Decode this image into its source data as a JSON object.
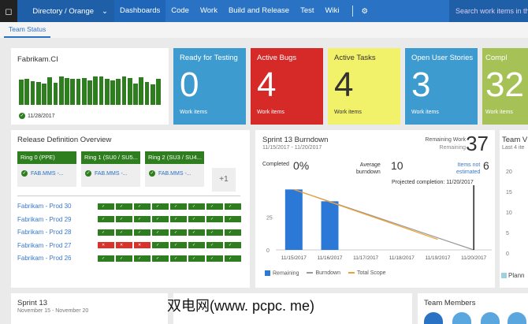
{
  "topnav": {
    "directory": "Directory / Orange",
    "items": [
      "Dashboards",
      "Code",
      "Work",
      "Build and Release",
      "Test",
      "Wiki"
    ],
    "active": "Dashboards",
    "search_placeholder": "Search work items in this"
  },
  "subnav": {
    "tab": "Team Status"
  },
  "build": {
    "title": "Fabrikam.CI",
    "date": "11/28/2017",
    "bar_heights": [
      0.72,
      0.74,
      0.68,
      0.66,
      0.62,
      0.8,
      0.63,
      0.82,
      0.78,
      0.75,
      0.75,
      0.78,
      0.7,
      0.82,
      0.82,
      0.76,
      0.7,
      0.76,
      0.82,
      0.78,
      0.62,
      0.8,
      0.66,
      0.6,
      0.74
    ],
    "color": "#2e7d1e"
  },
  "tiles": [
    {
      "title": "Ready for Testing",
      "value": "0",
      "sub": "Work items",
      "color": "#3d9bd0"
    },
    {
      "title": "Active Bugs",
      "value": "4",
      "sub": "Work items",
      "color": "#d62a28"
    },
    {
      "title": "Active Tasks",
      "value": "4",
      "sub": "Work items",
      "color": "#f2f26a"
    },
    {
      "title": "Open User Stories",
      "value": "3",
      "sub": "Work items",
      "color": "#3d9bd0"
    },
    {
      "title": "Compl",
      "value": "32",
      "sub": "Work items",
      "color": "#a6c256"
    }
  ],
  "release": {
    "title": "Release Definition Overview",
    "rings": [
      {
        "name": "Ring 0 (PPE)",
        "item": "FAB.MMS -..."
      },
      {
        "name": "Ring 1 (SU0 / SU5...",
        "item": "FAB.MMS -..."
      },
      {
        "name": "Ring 2 (SU3 / SU4...",
        "item": "FAB.MMS -..."
      }
    ],
    "more": "+1",
    "rows": [
      {
        "name": "Fabrikam - Prod  30",
        "failed": 0
      },
      {
        "name": "Fabrikam - Prod  29",
        "failed": 0
      },
      {
        "name": "Fabrikam - Prod  28",
        "failed": 0
      },
      {
        "name": "Fabrikam - Prod  27",
        "failed": 3
      },
      {
        "name": "Fabrikam - Prod  26",
        "failed": 0
      }
    ]
  },
  "burndown": {
    "title": "Sprint 13 Burndown",
    "dates": "11/15/2017 - 11/20/2017",
    "remaining_label": "Remaining Work",
    "remaining_sub": "Remaining",
    "remaining_value": "37",
    "completed_label": "Completed",
    "completed_value": "0%",
    "avg_label1": "Average",
    "avg_label2": "burndown",
    "avg_value": "10",
    "ne_label1": "Items not",
    "ne_label2": "estimated",
    "ne_value": "6",
    "projected": "Projected completion: 11/20/2017",
    "legend": [
      "Remaining",
      "Burndown",
      "Total Scope"
    ]
  },
  "chart_data": {
    "type": "bar",
    "categories": [
      "11/15/2017",
      "11/16/2017",
      "11/17/2017",
      "11/18/2017",
      "11/19/2017",
      "11/20/2017"
    ],
    "series": [
      {
        "name": "Remaining",
        "type": "bar",
        "values": [
          46,
          37,
          null,
          null,
          null,
          null
        ]
      },
      {
        "name": "Burndown",
        "type": "line",
        "values": [
          46,
          36.8,
          27.6,
          18.4,
          9.2,
          0
        ]
      },
      {
        "name": "Total Scope",
        "type": "line",
        "values": [
          46,
          36.5,
          27,
          17.5,
          8,
          null
        ]
      }
    ],
    "yticks": [
      0,
      25
    ],
    "ylim": [
      0,
      48
    ]
  },
  "velocity": {
    "title": "Team V",
    "sub": "Last 4 ite",
    "yticks": [
      "20",
      "15",
      "10",
      "5",
      "0"
    ],
    "legend": "Plann"
  },
  "sprint": {
    "title": "Sprint 13",
    "dates": "November 15 - November 20"
  },
  "members": {
    "title": "Team Members"
  },
  "watermark": "双电网(www. pcpc. me)"
}
